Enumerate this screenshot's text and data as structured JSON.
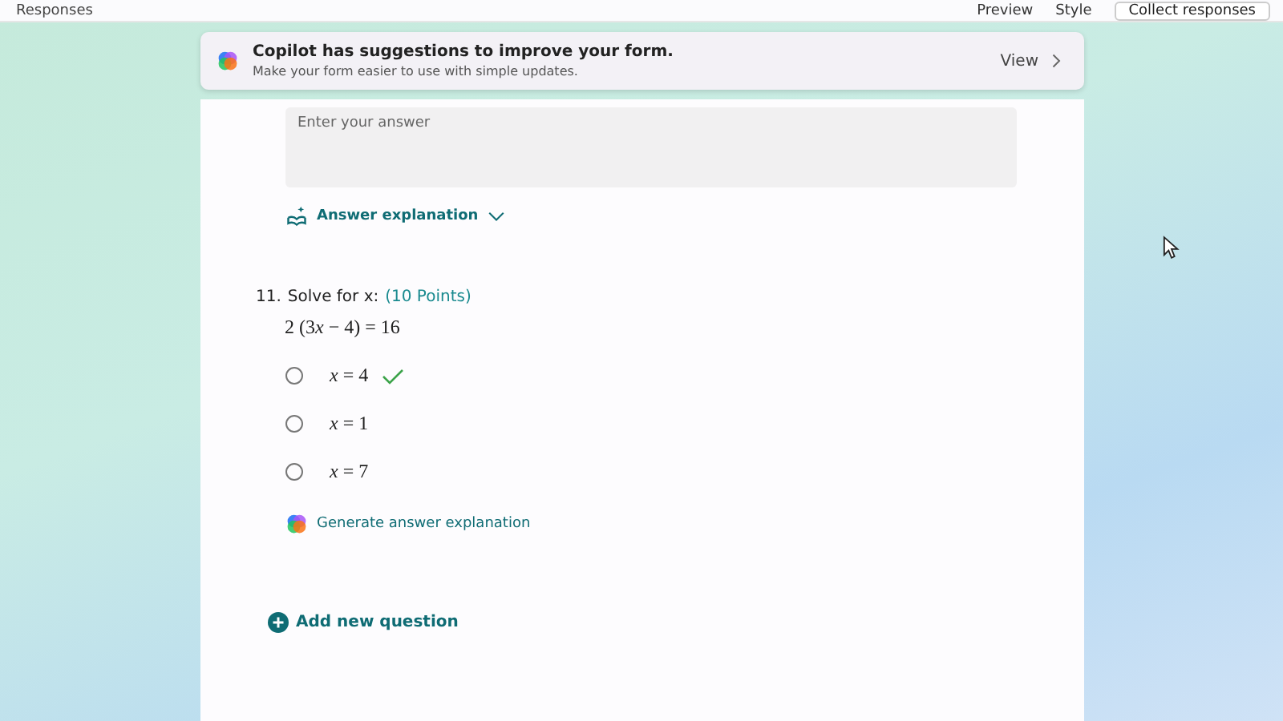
{
  "top_bar": {
    "left_label": "Responses",
    "preview": "Preview",
    "style": "Style",
    "collect": "Collect responses"
  },
  "banner": {
    "title": "Copilot has suggestions to improve your form.",
    "subtitle": "Make your form easier to use with simple updates.",
    "action": "View"
  },
  "previous_question": {
    "answer_placeholder": "Enter your answer",
    "explanation_link": "Answer explanation",
    "expanded": false
  },
  "question": {
    "number": "11.",
    "title": "Solve for x:",
    "points": "(10 Points)",
    "equation": [
      {
        "text": "2 (3"
      },
      {
        "text": "x",
        "italic": true
      },
      {
        "text": " − 4) = 16"
      }
    ],
    "options": [
      {
        "label": "*x* = 4",
        "selected": false,
        "correct": true
      },
      {
        "label": "*x* = 1",
        "selected": false,
        "correct": false
      },
      {
        "label": "*x* = 7",
        "selected": false,
        "correct": false
      }
    ],
    "generate_link": "Generate answer explanation"
  },
  "add_question": "Add new question"
}
